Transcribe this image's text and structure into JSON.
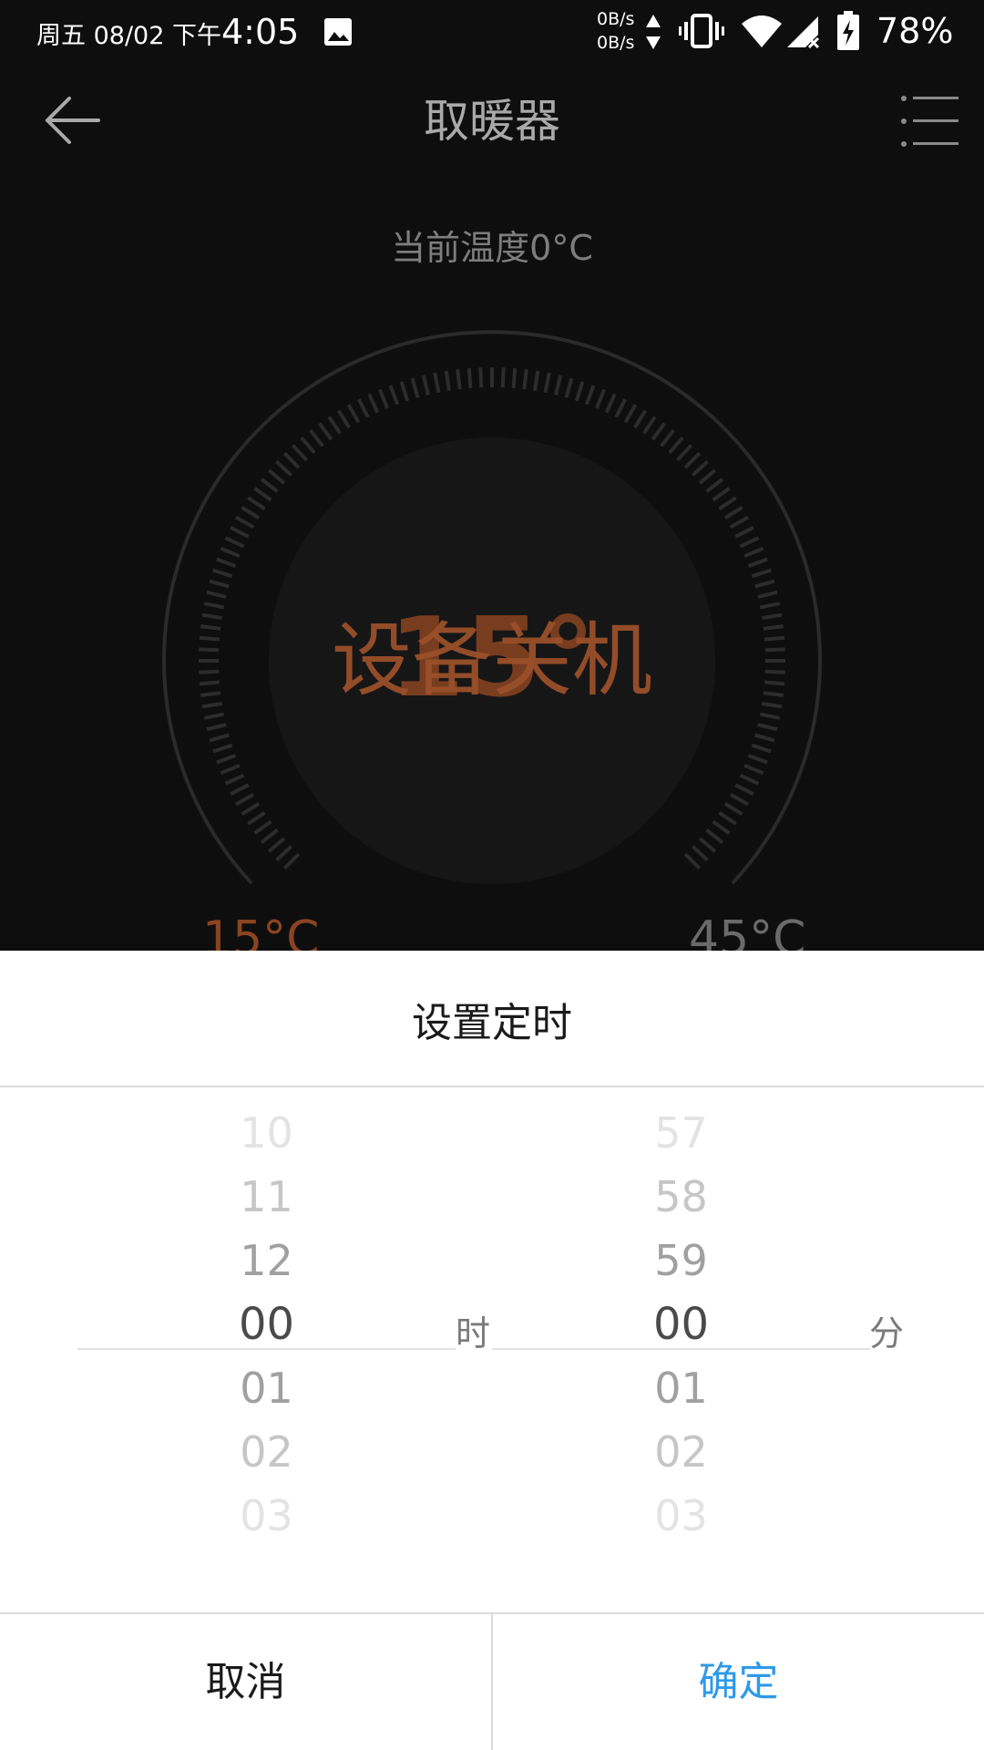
{
  "status_bar": {
    "day_date": "周五 08/02 下午",
    "time": "4:05",
    "net_up": "0B/s",
    "net_down": "0B/s",
    "battery": "78%"
  },
  "header": {
    "title": "取暖器"
  },
  "current_temperature": "当前温度0°C",
  "dial": {
    "status_text": "设备关机",
    "setpoint": "15°",
    "min_label": "15°C",
    "max_label": "45°C",
    "accent_color": "#9a4f29"
  },
  "timer_sheet": {
    "title": "设置定时",
    "hours": [
      "10",
      "11",
      "12",
      "00",
      "01",
      "02",
      "03"
    ],
    "hours_unit": "时",
    "minutes": [
      "57",
      "58",
      "59",
      "00",
      "01",
      "02",
      "03"
    ],
    "minutes_unit": "分",
    "selected_hour": "00",
    "selected_minute": "00",
    "cancel_label": "取消",
    "confirm_label": "确定",
    "confirm_color": "#2e9ae8"
  }
}
